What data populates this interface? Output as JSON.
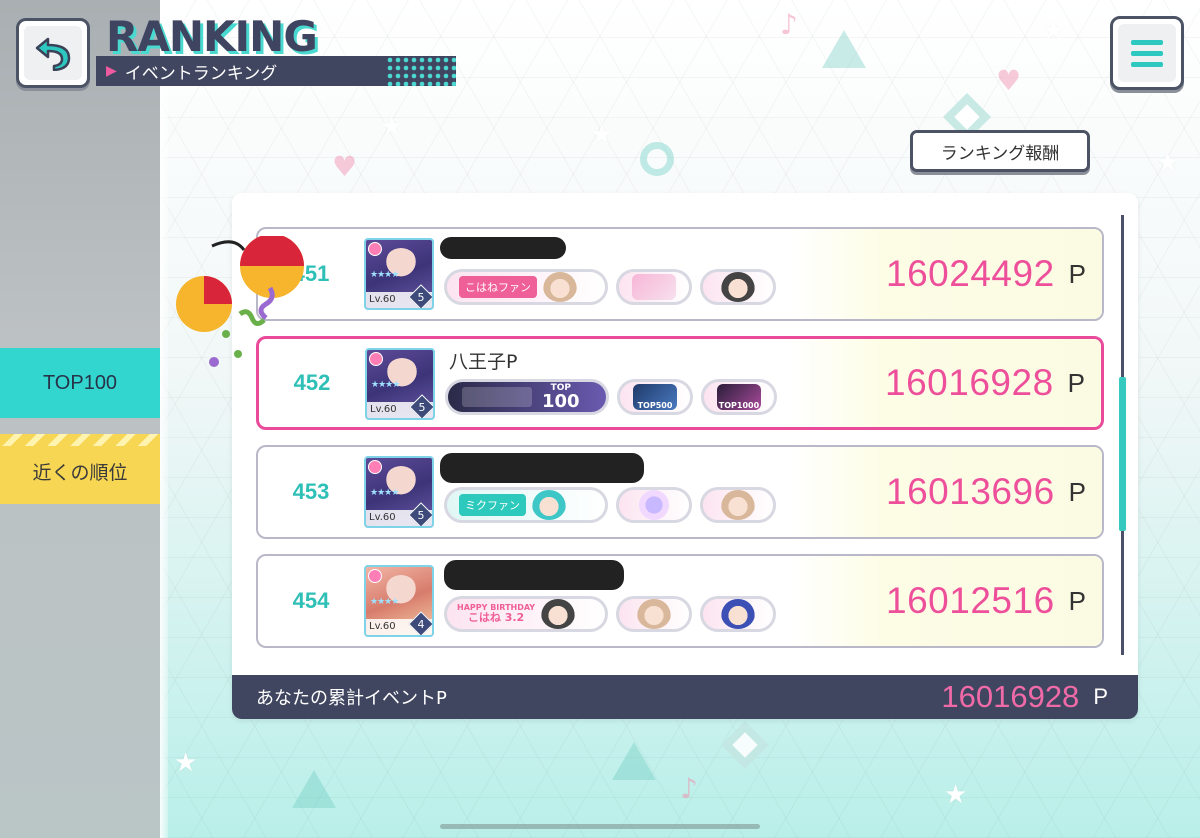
{
  "header": {
    "title": "RANKING",
    "subtitle": "イベントランキング",
    "back_icon": "back-arrow-icon",
    "menu_icon": "hamburger-menu-icon"
  },
  "reward_button": "ランキング報酬",
  "sidebar": {
    "tabs": [
      {
        "label": "TOP100",
        "active": true
      },
      {
        "label": "近くの順位",
        "active": false
      }
    ]
  },
  "rows": [
    {
      "rank": "451",
      "name": "",
      "name_hidden": true,
      "card_level": "Lv.60",
      "card_rank": "5",
      "title_main": "こはねファン",
      "score": "16024492",
      "unit": "P"
    },
    {
      "rank": "452",
      "name": "八王子P",
      "name_hidden": false,
      "card_level": "Lv.60",
      "card_rank": "5",
      "title_main_top": "TOP",
      "title_main_value": "100",
      "title_small_2": "TOP500",
      "title_small_3": "TOP1000",
      "score": "16016928",
      "unit": "P",
      "is_mine": true
    },
    {
      "rank": "453",
      "name": "",
      "name_hidden": true,
      "card_level": "Lv.60",
      "card_rank": "5",
      "title_main": "ミクファン",
      "score": "16013696",
      "unit": "P"
    },
    {
      "rank": "454",
      "name": "",
      "name_hidden": true,
      "card_level": "Lv.60",
      "card_rank": "4",
      "title_main_line1": "HAPPY BIRTHDAY",
      "title_main_line2": "こはね 3.2",
      "score": "16012516",
      "unit": "P"
    }
  ],
  "footer": {
    "label": "あなたの累計イベントP",
    "value": "16016928",
    "unit": "P"
  },
  "colors": {
    "accent_teal": "#33d6cf",
    "accent_pink": "#ee4f9b",
    "accent_yellow": "#f6d653",
    "navy": "#414660"
  }
}
